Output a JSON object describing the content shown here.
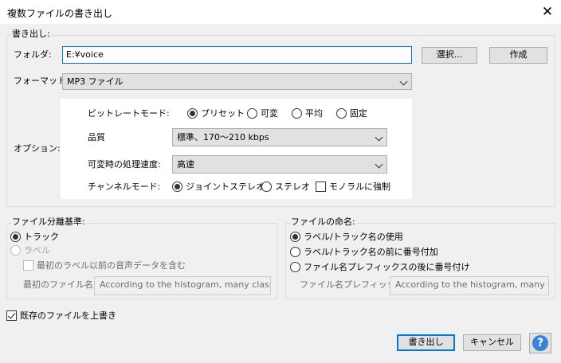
{
  "window": {
    "title": "複数ファイルの書き出し",
    "close_glyph": "✕"
  },
  "export_group": {
    "legend": "書き出し:",
    "folder_label": "フォルダ:",
    "folder_value": "E:¥voice",
    "choose_button": "選択...",
    "create_button": "作成",
    "format_label": "フォーマット:",
    "format_value": "MP3 ファイル",
    "options_label": "オプション:"
  },
  "mp3_options": {
    "bitrate_mode_label": "ビットレートモード:",
    "bitrate_modes": [
      "プリセット",
      "可変",
      "平均",
      "固定"
    ],
    "bitrate_selected": "プリセット",
    "quality_label": "品質",
    "quality_value": "標準、170～210 kbps",
    "variable_speed_label": "可変時の処理速度:",
    "variable_speed_value": "高速",
    "channel_mode_label": "チャンネルモード:",
    "channel_modes": [
      "ジョイントステレオ",
      "ステレオ"
    ],
    "channel_selected": "ジョイントステレオ",
    "force_mono_label": "モノラルに強制",
    "force_mono_checked": false
  },
  "split_group": {
    "legend": "ファイル分離基準:",
    "option_tracks": "トラック",
    "option_labels": "ラベル",
    "selected": "トラック",
    "include_audio_before_first_label": "最初のラベル以前の音声データを含む",
    "first_file_name_label": "最初のファイル名:",
    "first_file_name_value": "According to the histogram, many classrc"
  },
  "naming_group": {
    "legend": "ファイルの命名:",
    "option_use_label": "ラベル/トラック名の使用",
    "option_number_before": "ラベル/トラック名の前に番号付加",
    "option_number_after_prefix": "ファイル名プレフィックスの後に番号付け",
    "selected": "ラベル/トラック名の使用",
    "prefix_label": "ファイル名プレフィックス:",
    "prefix_value": "According to the histogram, many cla"
  },
  "overwrite": {
    "label": "既存のファイルを上書き",
    "checked": true
  },
  "footer": {
    "export_button": "書き出し",
    "cancel_button": "キャンセル",
    "help_glyph": "?"
  },
  "colors": {
    "accent": "#0078d7",
    "help_icon": "#3a84d6"
  }
}
